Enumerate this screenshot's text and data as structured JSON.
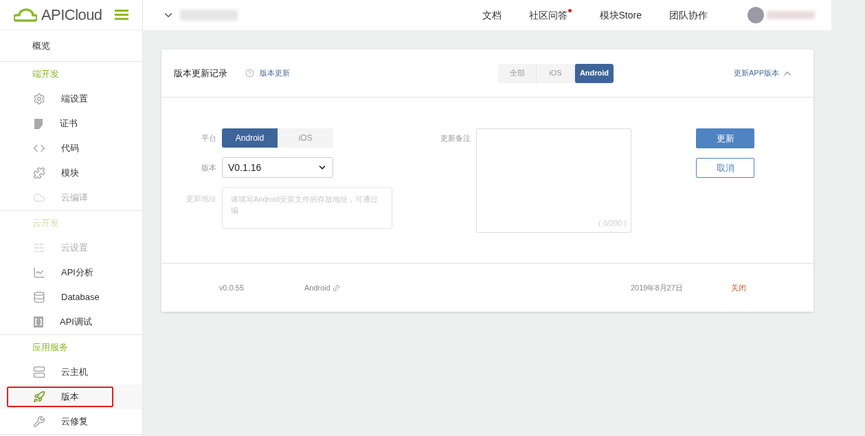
{
  "logo": {
    "text": "APICloud"
  },
  "topbar": {
    "nav": [
      {
        "label": "文档",
        "badge": false
      },
      {
        "label": "社区问答",
        "badge": true
      },
      {
        "label": "模块Store",
        "badge": false
      },
      {
        "label": "团队协作",
        "badge": false
      }
    ]
  },
  "sidebar": {
    "overview": "概览",
    "sections": [
      {
        "title": "端开发",
        "disabled": false,
        "items": [
          {
            "label": "端设置",
            "kind": "gear",
            "disabled": false,
            "selected": false
          },
          {
            "label": "证书",
            "kind": "certificate",
            "disabled": false,
            "selected": false
          },
          {
            "label": "代码",
            "kind": "code",
            "disabled": false,
            "selected": false
          },
          {
            "label": "模块",
            "kind": "puzzle",
            "disabled": false,
            "selected": false
          },
          {
            "label": "云编译",
            "kind": "cloud",
            "disabled": true,
            "selected": false
          }
        ]
      },
      {
        "title": "云开发",
        "disabled": true,
        "items": [
          {
            "label": "云设置",
            "kind": "sliders",
            "disabled": true,
            "selected": false
          },
          {
            "label": "API分析",
            "kind": "chart",
            "disabled": false,
            "selected": false
          },
          {
            "label": "Database",
            "kind": "database",
            "disabled": false,
            "selected": false
          },
          {
            "label": "API调试",
            "kind": "debug",
            "disabled": false,
            "selected": false
          }
        ]
      },
      {
        "title": "应用服务",
        "disabled": false,
        "items": [
          {
            "label": "云主机",
            "kind": "server",
            "disabled": false,
            "selected": false
          },
          {
            "label": "版本",
            "kind": "rocket",
            "disabled": false,
            "selected": true
          },
          {
            "label": "云修复",
            "kind": "wrench",
            "disabled": false,
            "selected": false
          }
        ]
      }
    ]
  },
  "card": {
    "title": "版本更新记录",
    "help_link": "版本更新",
    "filter_tabs": [
      {
        "label": "全部",
        "selected": false
      },
      {
        "label": "iOS",
        "selected": false
      },
      {
        "label": "Android",
        "selected": true
      }
    ],
    "toggle_link": "更新APP版本",
    "expanded": true,
    "form": {
      "platform_label": "平台",
      "platforms": [
        {
          "label": "Android",
          "selected": true
        },
        {
          "label": "iOS",
          "selected": false
        }
      ],
      "version_label": "版本",
      "version_value": "V0.1.16",
      "url_label": "更新地址",
      "url_placeholder": "请填写Android安装文件的存放地址，可通过编",
      "notes_label": "更新备注",
      "notes_counter": "( 0/200 )",
      "buttons": [
        {
          "label": "更新",
          "kind": "primary"
        },
        {
          "label": "取消",
          "kind": "secondary"
        }
      ]
    },
    "records": [
      {
        "version": "v0.0.55",
        "platform": "Android",
        "date": "2019年8月27日",
        "action": "关闭"
      }
    ]
  }
}
